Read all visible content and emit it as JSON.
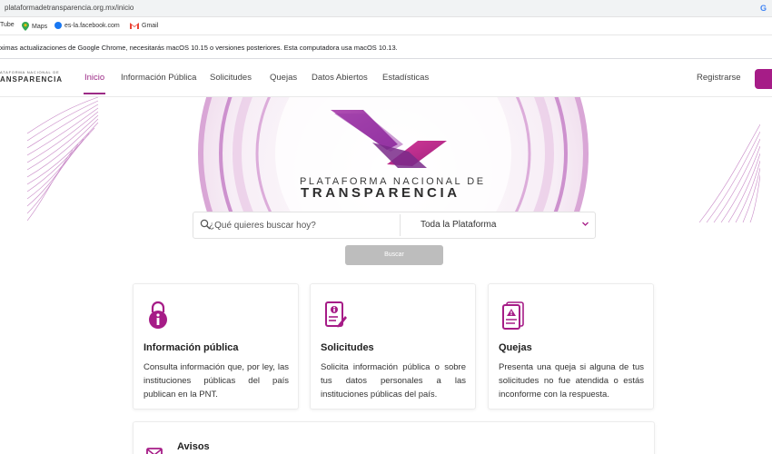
{
  "browser": {
    "url": "plataformadetransparencia.org.mx/inicio",
    "bookmarks": [
      {
        "label": "Tube",
        "icon": "youtube-icon"
      },
      {
        "label": "Maps",
        "icon": "maps-icon"
      },
      {
        "label": "es-la.facebook.com",
        "icon": "facebook-icon"
      },
      {
        "label": "Gmail",
        "icon": "gmail-icon"
      }
    ],
    "infobar_text": "ximas actualizaciones de Google Chrome, necesitarás macOS 10.15 o versiones posteriores. Esta computadora usa macOS 10.13."
  },
  "site": {
    "logo_line1": "ATAFORMA NACIONAL DE",
    "logo_line2": "ANSPARENCIA",
    "nav": [
      {
        "label": "Inicio",
        "active": true
      },
      {
        "label": "Información Pública",
        "active": false
      },
      {
        "label": "Solicitudes",
        "active": false
      },
      {
        "label": "Quejas",
        "active": false
      },
      {
        "label": "Datos Abiertos",
        "active": false
      },
      {
        "label": "Estadísticas",
        "active": false
      }
    ],
    "register_label": "Registrarse",
    "accent_color": "#a61c87"
  },
  "hero": {
    "title_line1": "PLATAFORMA NACIONAL DE",
    "title_line2": "TRANSPARENCIA"
  },
  "search": {
    "placeholder": "¿Qué quieres buscar hoy?",
    "scope": "Toda la Plataforma",
    "button_label": "Buscar"
  },
  "cards": [
    {
      "icon": "lock-info-icon",
      "title": "Información pública",
      "description": "Consulta información que, por ley, las instituciones públicas del país publican en la PNT."
    },
    {
      "icon": "document-edit-icon",
      "title": "Solicitudes",
      "description": "Solicita información pública o sobre tus datos personales a las instituciones públicas del país."
    },
    {
      "icon": "warning-document-icon",
      "title": "Quejas",
      "description": "Presenta una queja si alguna de tus solicitudes no fue atendida o estás inconforme con la respuesta."
    }
  ],
  "avisos": {
    "title": "Avisos",
    "icon": "envelope-icon"
  }
}
